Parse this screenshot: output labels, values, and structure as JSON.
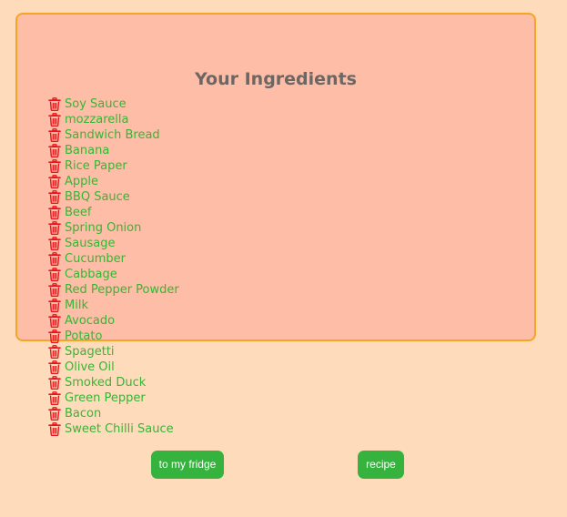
{
  "panel": {
    "title": "Your Ingredients"
  },
  "ingredients": [
    {
      "name": "Soy Sauce",
      "icon": "trash-icon"
    },
    {
      "name": "mozzarella",
      "icon": "trash-icon"
    },
    {
      "name": "Sandwich Bread",
      "icon": "trash-icon"
    },
    {
      "name": "Banana",
      "icon": "trash-icon"
    },
    {
      "name": "Rice Paper",
      "icon": "trash-icon"
    },
    {
      "name": "Apple",
      "icon": "trash-icon"
    },
    {
      "name": "BBQ Sauce",
      "icon": "trash-icon"
    },
    {
      "name": "Beef",
      "icon": "trash-icon"
    },
    {
      "name": "Spring Onion",
      "icon": "trash-icon"
    },
    {
      "name": "Sausage",
      "icon": "trash-icon"
    },
    {
      "name": "Cucumber",
      "icon": "trash-icon"
    },
    {
      "name": "Cabbage",
      "icon": "trash-icon"
    },
    {
      "name": "Red Pepper Powder",
      "icon": "trash-icon"
    },
    {
      "name": "Milk",
      "icon": "trash-icon"
    },
    {
      "name": "Avocado",
      "icon": "trash-icon"
    },
    {
      "name": "Potato",
      "icon": "trash-icon"
    },
    {
      "name": "Spagetti",
      "icon": "trash-icon"
    },
    {
      "name": "Olive Oil",
      "icon": "trash-icon"
    },
    {
      "name": "Smoked Duck",
      "icon": "trash-icon"
    },
    {
      "name": "Green Pepper",
      "icon": "trash-icon"
    },
    {
      "name": "Bacon",
      "icon": "trash-icon"
    },
    {
      "name": "Sweet Chilli Sauce",
      "icon": "trash-icon"
    }
  ],
  "buttons": {
    "fridge_label": "to my fridge",
    "recipe_label": "recipe"
  },
  "colors": {
    "background": "#fedbbb",
    "panel_fill": "#febda6",
    "panel_border": "#f5a524",
    "ingredient_text": "#35b635",
    "trash_icon": "#e8141e",
    "button": "#36b23e",
    "title_text": "#6e6663"
  }
}
